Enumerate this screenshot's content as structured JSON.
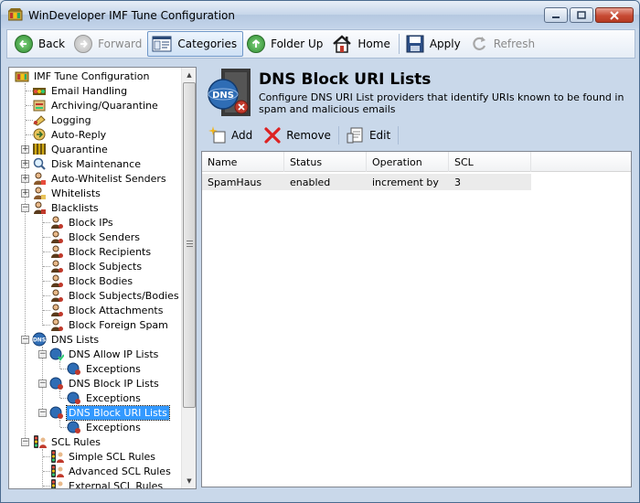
{
  "window": {
    "title": "WinDeveloper IMF Tune Configuration"
  },
  "toolbar": {
    "back": "Back",
    "forward": "Forward",
    "categories": "Categories",
    "folder_up": "Folder Up",
    "home": "Home",
    "apply": "Apply",
    "refresh": "Refresh"
  },
  "tree": {
    "root": "IMF Tune Configuration",
    "email_handling": "Email Handling",
    "archiving": "Archiving/Quarantine",
    "logging": "Logging",
    "auto_reply": "Auto-Reply",
    "quarantine": "Quarantine",
    "disk_maintenance": "Disk Maintenance",
    "auto_whitelist": "Auto-Whitelist Senders",
    "whitelists": "Whitelists",
    "blacklists": "Blacklists",
    "block_ips": "Block IPs",
    "block_senders": "Block Senders",
    "block_recipients": "Block Recipients",
    "block_subjects": "Block Subjects",
    "block_bodies": "Block Bodies",
    "block_subjects_bodies": "Block Subjects/Bodies",
    "block_attachments": "Block Attachments",
    "block_foreign_spam": "Block Foreign Spam",
    "dns_lists": "DNS Lists",
    "dns_allow_ip": "DNS Allow IP Lists",
    "exceptions_1": "Exceptions",
    "dns_block_ip": "DNS Block IP Lists",
    "exceptions_2": "Exceptions",
    "dns_block_uri": "DNS Block URI Lists",
    "exceptions_3": "Exceptions",
    "scl_rules": "SCL Rules",
    "simple_scl": "Simple SCL Rules",
    "advanced_scl": "Advanced SCL Rules",
    "external_scl": "External SCL Rules"
  },
  "panel": {
    "icon_text": "DNS",
    "title": "DNS Block URI Lists",
    "description": "Configure DNS URI List providers that identify URIs known to be found in spam and malicious emails",
    "add": "Add",
    "remove": "Remove",
    "edit": "Edit"
  },
  "list": {
    "columns": [
      "Name",
      "Status",
      "Operation",
      "SCL"
    ],
    "rows": [
      {
        "name": "SpamHaus",
        "status": "enabled",
        "operation": "increment by",
        "scl": "3"
      }
    ]
  }
}
